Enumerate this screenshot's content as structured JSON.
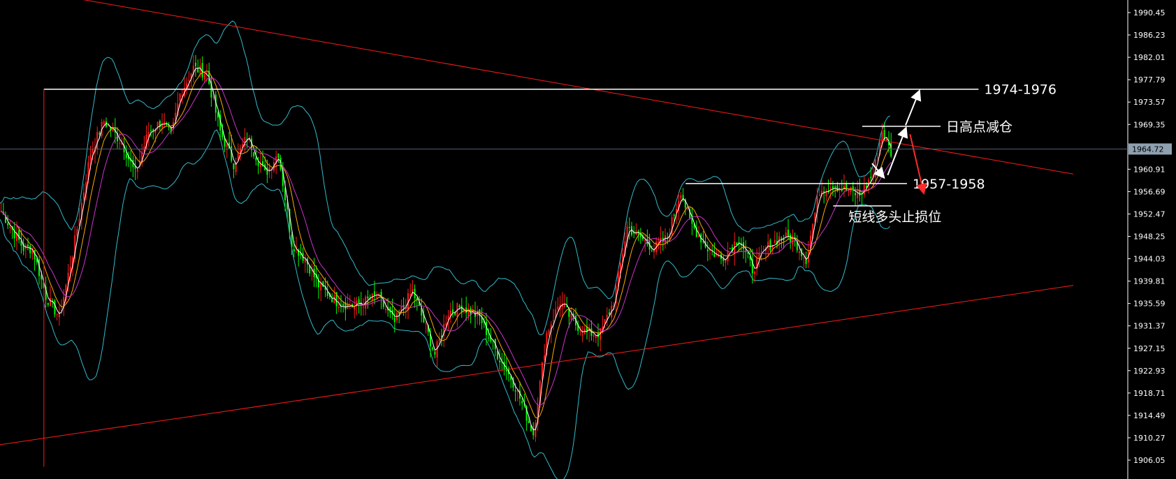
{
  "chart_data": {
    "type": "candlestick",
    "y_axis": {
      "ylim": [
        1904.8,
        1993.5
      ],
      "ticks": [
        "1990.45",
        "1986.23",
        "1982.01",
        "1977.79",
        "1973.57",
        "1969.35",
        "1960.91",
        "1956.69",
        "1952.47",
        "1948.25",
        "1944.03",
        "1939.81",
        "1935.59",
        "1931.37",
        "1927.15",
        "1922.93",
        "1918.71",
        "1914.49",
        "1910.27",
        "1906.05"
      ],
      "position": "right"
    },
    "current_price": {
      "label": "1964.72",
      "value": 1964.72,
      "color": "#8fa0b0"
    },
    "colors": {
      "up": "#ff1a1a",
      "down": "#00ff00",
      "trendline": "#ff1a1a",
      "bollinger": "#33bbcc",
      "ma_fast": "#ffffff",
      "ma_mid": "#ffaa00",
      "ma_slow": "#cc33cc",
      "annotation": "#ffffff",
      "arrow_bear": "#ff2a2a"
    },
    "x_axis": {
      "n_bars": 250,
      "first_bar_index": 0
    },
    "price_path": [
      [
        0,
        1953
      ],
      [
        10,
        1946
      ],
      [
        14,
        1946
      ],
      [
        20,
        1937
      ],
      [
        26,
        1933
      ],
      [
        32,
        1945
      ],
      [
        40,
        1964
      ],
      [
        46,
        1970
      ],
      [
        54,
        1966
      ],
      [
        60,
        1960
      ],
      [
        66,
        1968
      ],
      [
        72,
        1970
      ],
      [
        76,
        1967
      ],
      [
        80,
        1975
      ],
      [
        86,
        1980
      ],
      [
        92,
        1979
      ],
      [
        98,
        1968
      ],
      [
        104,
        1962
      ],
      [
        110,
        1967
      ],
      [
        118,
        1960
      ],
      [
        124,
        1964
      ],
      [
        130,
        1947
      ],
      [
        136,
        1944
      ],
      [
        142,
        1939
      ],
      [
        150,
        1936
      ],
      [
        158,
        1935
      ],
      [
        168,
        1937
      ],
      [
        176,
        1932
      ],
      [
        184,
        1938
      ],
      [
        190,
        1931
      ],
      [
        194,
        1926
      ],
      [
        200,
        1934
      ],
      [
        206,
        1935
      ],
      [
        214,
        1933
      ],
      [
        222,
        1926
      ],
      [
        230,
        1920
      ],
      [
        238,
        1911
      ],
      [
        244,
        1930
      ],
      [
        250,
        1936
      ],
      [
        256,
        1932
      ],
      [
        262,
        1930
      ],
      [
        268,
        1930
      ],
      [
        274,
        1936
      ],
      [
        280,
        1950
      ],
      [
        286,
        1948
      ],
      [
        292,
        1946
      ],
      [
        298,
        1948
      ],
      [
        304,
        1957
      ],
      [
        308,
        1951
      ],
      [
        316,
        1946
      ],
      [
        322,
        1944
      ],
      [
        330,
        1948
      ],
      [
        336,
        1942
      ],
      [
        342,
        1946
      ],
      [
        348,
        1948
      ],
      [
        354,
        1948
      ],
      [
        360,
        1944
      ],
      [
        366,
        1957
      ],
      [
        372,
        1958
      ],
      [
        378,
        1957
      ],
      [
        384,
        1956
      ],
      [
        390,
        1960
      ],
      [
        394,
        1968
      ],
      [
        398,
        1964
      ]
    ],
    "trendlines": [
      {
        "name": "descending-resistance",
        "from": [
          40,
          1995
        ],
        "to": [
          480,
          1960
        ]
      },
      {
        "name": "ascending-support",
        "from": [
          0,
          1907
        ],
        "to": [
          480,
          1939
        ]
      }
    ],
    "levels": [
      {
        "label": "1974-1976",
        "value": 1976.0,
        "from_bar": 19,
        "to_bar": 437,
        "vertical_at_bar": 19,
        "vertical_to": 1904.8
      },
      {
        "label": "日高点减仓",
        "value": 1969.0,
        "from_bar": 385,
        "to_bar": 420
      },
      {
        "label": "1957-1958",
        "value": 1958.2,
        "from_bar": 306,
        "to_bar": 405
      },
      {
        "label": "短线多头止损位",
        "value": 1954.0,
        "from_bar": 372,
        "to_bar": 398
      }
    ]
  }
}
